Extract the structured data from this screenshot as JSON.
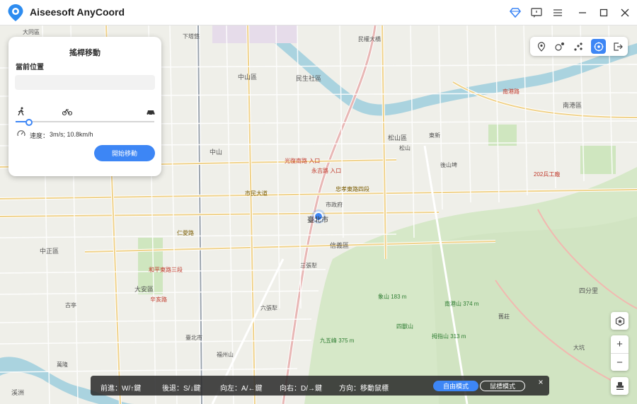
{
  "app": {
    "title": "Aiseesoft AnyCoord"
  },
  "panel": {
    "title": "搖桿移動",
    "current_location_label": "當前位置",
    "location_value": "",
    "speed_label": "速度：",
    "speed_value": "3m/s; 10.8km/h",
    "start_button": "開始移動",
    "speed_fraction": 0.09
  },
  "hints": {
    "forward": "前進：W/↑鍵",
    "back": "後退：S/↓鍵",
    "left": "向左：A/←鍵",
    "right": "向右：D/→鍵",
    "direction": "方向：移動鼠標",
    "free_mode": "自由模式",
    "mouse_mode": "鼠標模式",
    "close": "×"
  },
  "zoom": {
    "in": "+",
    "out": "−"
  },
  "map_labels": [
    {
      "text": "大同區",
      "cls": ""
    },
    {
      "text": "下塔悠",
      "cls": ""
    },
    {
      "text": "民權大橋",
      "cls": ""
    },
    {
      "text": "中山區",
      "cls": ""
    },
    {
      "text": "民生社區",
      "cls": ""
    },
    {
      "text": "松山區",
      "cls": ""
    },
    {
      "text": "南港區",
      "cls": ""
    },
    {
      "text": "中山",
      "cls": ""
    },
    {
      "text": "光復南路 入口",
      "cls": "red"
    },
    {
      "text": "永吉路 入口",
      "cls": "red"
    },
    {
      "text": "市政府",
      "cls": ""
    },
    {
      "text": "202兵工廠",
      "cls": "red"
    },
    {
      "text": "臺北市",
      "cls": ""
    },
    {
      "text": "中正區",
      "cls": ""
    },
    {
      "text": "大安區",
      "cls": ""
    },
    {
      "text": "信義區",
      "cls": ""
    },
    {
      "text": "三張犁",
      "cls": ""
    },
    {
      "text": "六張犁",
      "cls": ""
    },
    {
      "text": "臺北市",
      "cls": ""
    },
    {
      "text": "四分里",
      "cls": ""
    },
    {
      "text": "大坑",
      "cls": ""
    },
    {
      "text": "福州山",
      "cls": ""
    },
    {
      "text": "象山 183 m",
      "cls": "green"
    },
    {
      "text": "九五峰 375 m",
      "cls": "green"
    },
    {
      "text": "南港山 374 m",
      "cls": "green"
    },
    {
      "text": "拇指山 313 m",
      "cls": "green"
    },
    {
      "text": "四獸山",
      "cls": "green"
    },
    {
      "text": "溪洲",
      "cls": ""
    },
    {
      "text": "古亭",
      "cls": ""
    },
    {
      "text": "萬隆",
      "cls": ""
    },
    {
      "text": "仁愛路",
      "cls": "road"
    },
    {
      "text": "忠孝東路四段",
      "cls": "road"
    },
    {
      "text": "和平東路三段",
      "cls": "red"
    },
    {
      "text": "辛亥路",
      "cls": "red"
    },
    {
      "text": "市民大道",
      "cls": "road"
    },
    {
      "text": "南港路",
      "cls": "red"
    },
    {
      "text": "東新",
      "cls": ""
    },
    {
      "text": "後山埤",
      "cls": ""
    },
    {
      "text": "松山",
      "cls": ""
    },
    {
      "text": "舊莊",
      "cls": ""
    }
  ]
}
